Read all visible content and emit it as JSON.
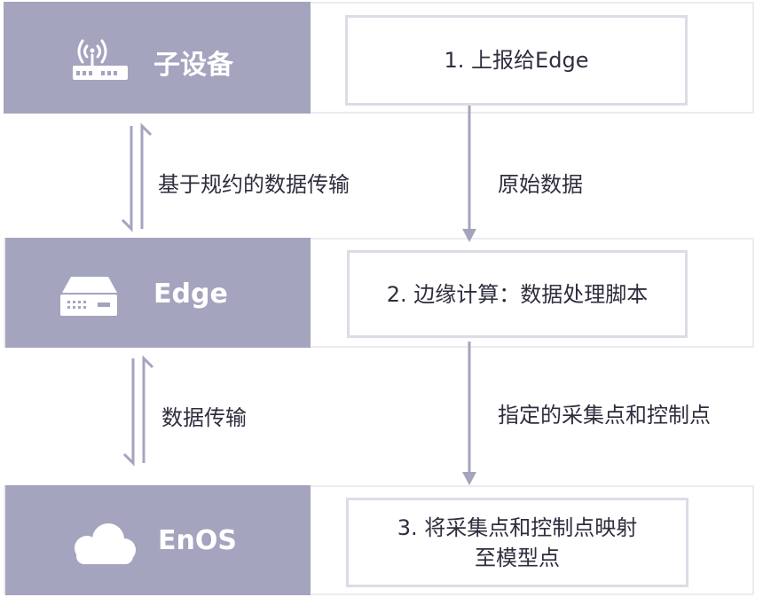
{
  "nodes": {
    "device": {
      "label": "子设备",
      "icon": "router-icon"
    },
    "edge": {
      "label": "Edge",
      "icon": "server-icon"
    },
    "enos": {
      "label": "EnOS",
      "icon": "cloud-icon"
    }
  },
  "steps": {
    "step1": "1. 上报给Edge",
    "step2": "2. 边缘计算：数据处理脚本",
    "step3_line1": "3. 将采集点和控制点映射",
    "step3_line2": "至模型点"
  },
  "edges": {
    "device_edge": "基于规约的数据传输",
    "edge_enos": "数据传输",
    "raw": "原始数据",
    "points": "指定的采集点和控制点"
  },
  "colors": {
    "block": "#a4a4bf",
    "arrow": "#a4a4bf",
    "text": "#2e2e3e",
    "border": "#dcdce6"
  }
}
